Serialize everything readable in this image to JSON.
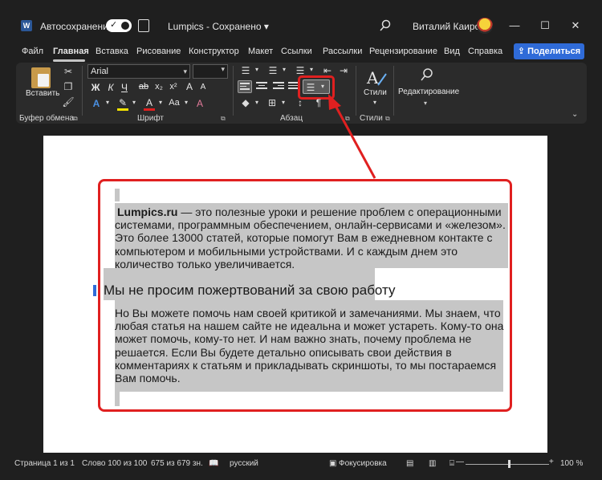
{
  "app": {
    "autosave_label": "Автосохранение",
    "doc_title": "Lumpics  -  Сохранено  ▾",
    "user_name": "Виталий Каиров",
    "word_letter": "W",
    "toggle_check": "✓"
  },
  "window_controls": {
    "minimize": "—",
    "maximize": "☐",
    "close": "✕"
  },
  "menu": {
    "items": [
      "Файл",
      "Главная",
      "Вставка",
      "Рисование",
      "Конструктор",
      "Макет",
      "Ссылки",
      "Рассылки",
      "Рецензирование",
      "Вид",
      "Справка"
    ],
    "active": "Главная",
    "share_label": "Поделиться",
    "share_icon": "share-icon"
  },
  "ribbon": {
    "clipboard": {
      "paste_label": "Вставить",
      "group_label": "Буфер обмена"
    },
    "font": {
      "font_name": "Arial",
      "font_size": "",
      "group_label": "Шрифт",
      "bold": "Ж",
      "italic": "К",
      "underline": "Ч",
      "strike": "ab",
      "subscript": "x₂",
      "superscript": "x²",
      "grow": "A",
      "shrink": "A",
      "case": "Aa",
      "clear": "A"
    },
    "paragraph": {
      "group_label": "Абзац",
      "pilcrow": "¶",
      "sort": "↕"
    },
    "styles": {
      "label": "Стили",
      "group_label": "Стили"
    },
    "editing": {
      "label": "Редактирование"
    }
  },
  "document": {
    "paragraph1": {
      "brand": "Lumpics.ru",
      "lines": [
        " — это полезные уроки и решение проблем с операционными",
        "системами, программным обеспечением, онлайн-сервисами и «железом».",
        "Это более 13000 статей, которые помогут Вам в ежедневном контакте с",
        "компьютером и мобильными устройствами. И с каждым днем это",
        "количество только увеличивается."
      ]
    },
    "heading": "Мы не просим пожертвований за свою работу",
    "paragraph2": {
      "lines": [
        "Но Вы можете помочь нам своей критикой и замечаниями. Мы знаем, что",
        "любая статья на нашем сайте не идеальна и может устареть. Кому-то она",
        "может помочь, кому-то нет. И нам важно знать, почему проблема не",
        "решается. Если Вы будете детально описывать свои действия в",
        "комментариях к статьям и прикладывать скриншоты, то мы постараемся",
        "Вам помочь."
      ]
    }
  },
  "statusbar": {
    "page": "Страница 1 из 1",
    "words": "Слово 100 из 100",
    "chars": "675 из 679 зн.",
    "language": "русский",
    "focus": "Фокусировка",
    "zoom": "100 %",
    "zoom_minus": "—",
    "zoom_plus": "+"
  },
  "colors": {
    "accent": "#2f6bd8",
    "highlight_frame": "#e02020",
    "selection": "#c6c6c6",
    "background": "#1f1f1f"
  }
}
